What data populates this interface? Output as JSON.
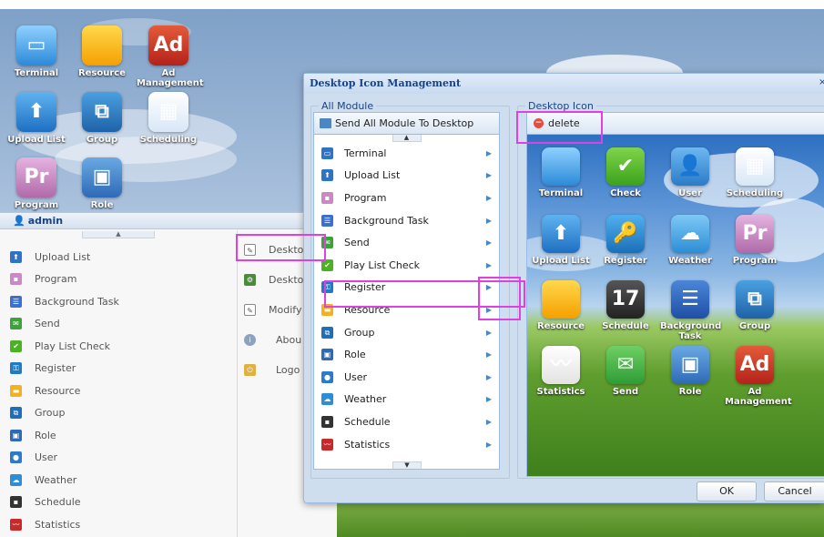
{
  "desktop": {
    "icons": [
      {
        "id": "terminal",
        "label": "Terminal",
        "icon": "monitor-icon"
      },
      {
        "id": "resource",
        "label": "Resource",
        "icon": "folder-icon"
      },
      {
        "id": "ad",
        "label": "Ad Management",
        "icon": "ad-icon",
        "glyph": "Ad"
      },
      {
        "id": "upload",
        "label": "Upload List",
        "icon": "upload-arrow-icon"
      },
      {
        "id": "group",
        "label": "Group",
        "icon": "group-icon"
      },
      {
        "id": "scheduling",
        "label": "Scheduling",
        "icon": "calendar-grid-icon"
      },
      {
        "id": "program",
        "label": "Program",
        "icon": "program-icon",
        "glyph": "Pr"
      },
      {
        "id": "role",
        "label": "Role",
        "icon": "role-icon"
      }
    ]
  },
  "admin_panel": {
    "title": "admin",
    "menu": [
      {
        "label": "Upload List",
        "icon": "upload-icon",
        "color": "#2f73c5"
      },
      {
        "label": "Program",
        "icon": "program-icon",
        "color": "#c98ac4"
      },
      {
        "label": "Background Task",
        "icon": "task-icon",
        "color": "#3b6fd0"
      },
      {
        "label": "Send",
        "icon": "send-icon",
        "color": "#3aa33a"
      },
      {
        "label": "Play List Check",
        "icon": "check-icon",
        "color": "#4bb224"
      },
      {
        "label": "Register",
        "icon": "register-icon",
        "color": "#1f7cc4"
      },
      {
        "label": "Resource",
        "icon": "folder-icon",
        "color": "#f3b21d"
      },
      {
        "label": "Group",
        "icon": "group-icon",
        "color": "#1f6fb6"
      },
      {
        "label": "Role",
        "icon": "role-icon",
        "color": "#2b6ab6"
      },
      {
        "label": "User",
        "icon": "user-icon",
        "color": "#2c7bc8"
      },
      {
        "label": "Weather",
        "icon": "weather-icon",
        "color": "#2c8ed6"
      },
      {
        "label": "Schedule",
        "icon": "schedule-icon",
        "color": "#333333"
      },
      {
        "label": "Statistics",
        "icon": "statistics-icon",
        "color": "#c62a2a"
      }
    ],
    "context_menu": [
      {
        "label": "Desktop",
        "icon": "desktop-edit-icon"
      },
      {
        "label": "Desktop B",
        "icon": "gear-icon"
      },
      {
        "label": "Modify Pa",
        "icon": "edit-icon"
      },
      {
        "label": "Abou",
        "icon": "info-icon"
      },
      {
        "label": "Logo",
        "icon": "logout-icon"
      }
    ]
  },
  "dialog": {
    "title": "Desktop Icon Management",
    "close_glyph": "×",
    "all_module": {
      "legend": "All Module",
      "toolbar_label": "Send All Module To Desktop",
      "items": [
        {
          "label": "Terminal",
          "icon": "terminal-icon",
          "color": "#2f73c5"
        },
        {
          "label": "Upload List",
          "icon": "upload-icon",
          "color": "#2f73c5"
        },
        {
          "label": "Program",
          "icon": "program-icon",
          "color": "#c98ac4"
        },
        {
          "label": "Background Task",
          "icon": "task-icon",
          "color": "#3b6fd0"
        },
        {
          "label": "Send",
          "icon": "send-icon",
          "color": "#3aa33a"
        },
        {
          "label": "Play List Check",
          "icon": "check-icon",
          "color": "#4bb224"
        },
        {
          "label": "Register",
          "icon": "register-icon",
          "color": "#1f7cc4"
        },
        {
          "label": "Resource",
          "icon": "folder-icon",
          "color": "#f3b21d"
        },
        {
          "label": "Group",
          "icon": "group-icon",
          "color": "#1f6fb6"
        },
        {
          "label": "Role",
          "icon": "role-icon",
          "color": "#2b6ab6"
        },
        {
          "label": "User",
          "icon": "user-icon",
          "color": "#2c7bc8"
        },
        {
          "label": "Weather",
          "icon": "weather-icon",
          "color": "#2c8ed6"
        },
        {
          "label": "Schedule",
          "icon": "schedule-icon",
          "color": "#333333"
        },
        {
          "label": "Statistics",
          "icon": "statistics-icon",
          "color": "#c62a2a"
        }
      ]
    },
    "desktop_icon": {
      "legend": "Desktop Icon",
      "delete_label": "delete",
      "icons": [
        {
          "label": "Terminal",
          "cls": "t-term",
          "glyph": ""
        },
        {
          "label": "Check",
          "cls": "t-check",
          "glyph": "✔"
        },
        {
          "label": "User",
          "cls": "t-user",
          "glyph": "👤"
        },
        {
          "label": "Scheduling",
          "cls": "t-sch",
          "glyph": "▦"
        },
        {
          "label": "Upload List",
          "cls": "t-up",
          "glyph": "⬆"
        },
        {
          "label": "Register",
          "cls": "t-reg",
          "glyph": "🔑"
        },
        {
          "label": "Weather",
          "cls": "t-wea",
          "glyph": "☁"
        },
        {
          "label": "Program",
          "cls": "t-pr",
          "glyph": "Pr"
        },
        {
          "label": "Resource",
          "cls": "t-res",
          "glyph": ""
        },
        {
          "label": "Schedule",
          "cls": "t-schd",
          "glyph": "17"
        },
        {
          "label": "Background Task",
          "cls": "t-bg",
          "glyph": "☰"
        },
        {
          "label": "Group",
          "cls": "t-grp",
          "glyph": "⧉"
        },
        {
          "label": "Statistics",
          "cls": "t-stat",
          "glyph": "〰"
        },
        {
          "label": "Send",
          "cls": "t-send",
          "glyph": "✉"
        },
        {
          "label": "Role",
          "cls": "t-role",
          "glyph": "▣"
        },
        {
          "label": "Ad Management",
          "cls": "t-ad",
          "glyph": "Ad"
        }
      ]
    },
    "ok_label": "OK",
    "cancel_label": "Cancel"
  }
}
